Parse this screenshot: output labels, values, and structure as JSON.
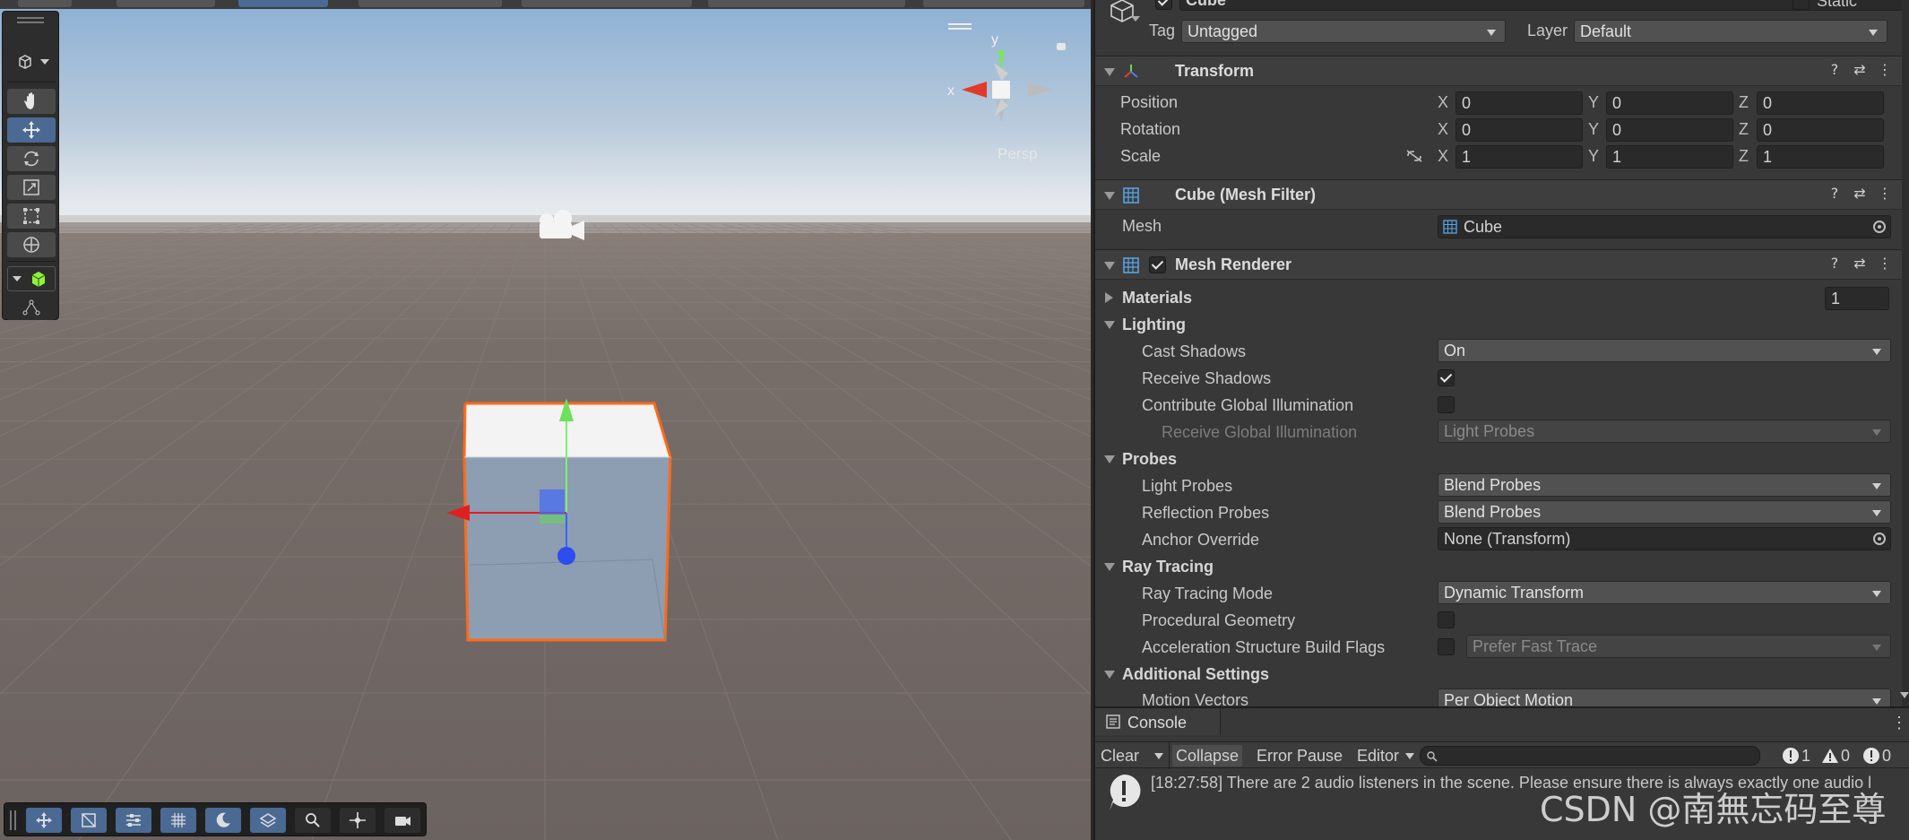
{
  "scene": {
    "gizmo": {
      "persp_label": "Persp",
      "x_label": "x",
      "y_label": "y"
    },
    "tools": [
      "hand-tool",
      "move-tool",
      "rotate-tool",
      "scale-tool",
      "rect-tool",
      "transform-tool",
      "custom-tool",
      "component-tool"
    ],
    "bottom_tools": [
      "move-view",
      "grid-snap",
      "align-tool",
      "grid-tool",
      "orbit-tool",
      "snap-tool",
      "zoom-tool",
      "pivot-tool",
      "camera-tool"
    ]
  },
  "inspector": {
    "object_name": "Cube",
    "static_label": "Static",
    "tag_label": "Tag",
    "tag_value": "Untagged",
    "layer_label": "Layer",
    "layer_value": "Default",
    "transform": {
      "title": "Transform",
      "position_label": "Position",
      "rotation_label": "Rotation",
      "scale_label": "Scale",
      "axis_x": "X",
      "axis_y": "Y",
      "axis_z": "Z",
      "position": [
        "0",
        "0",
        "0"
      ],
      "rotation": [
        "0",
        "0",
        "0"
      ],
      "scale": [
        "1",
        "1",
        "1"
      ]
    },
    "mesh_filter": {
      "title": "Cube (Mesh Filter)",
      "mesh_label": "Mesh",
      "mesh_value": "Cube"
    },
    "mesh_renderer": {
      "title": "Mesh Renderer",
      "materials_label": "Materials",
      "materials_count": "1",
      "lighting_label": "Lighting",
      "cast_shadows_label": "Cast Shadows",
      "cast_shadows_value": "On",
      "receive_shadows_label": "Receive Shadows",
      "contribute_gi_label": "Contribute Global Illumination",
      "receive_gi_label": "Receive Global Illumination",
      "receive_gi_value": "Light Probes",
      "probes_label": "Probes",
      "light_probes_label": "Light Probes",
      "light_probes_value": "Blend Probes",
      "reflection_probes_label": "Reflection Probes",
      "reflection_probes_value": "Blend Probes",
      "anchor_override_label": "Anchor Override",
      "anchor_override_value": "None (Transform)",
      "ray_tracing_label": "Ray Tracing",
      "ray_tracing_mode_label": "Ray Tracing Mode",
      "ray_tracing_mode_value": "Dynamic Transform",
      "procedural_geometry_label": "Procedural Geometry",
      "accel_flags_label": "Acceleration Structure Build Flags",
      "accel_flags_value": "Prefer Fast Trace",
      "additional_settings_label": "Additional Settings",
      "motion_vectors_label": "Motion Vectors",
      "motion_vectors_value": "Per Object Motion"
    }
  },
  "console": {
    "tab_label": "Console",
    "clear_label": "Clear",
    "collapse_label": "Collapse",
    "error_pause_label": "Error Pause",
    "editor_label": "Editor",
    "info_count": "1",
    "warning_count": "0",
    "error_count": "0",
    "message": "[18:27:58] There are 2 audio listeners in the scene. Please ensure there is always exactly one audio l"
  },
  "watermark": "CSDN @南無忘码至尊",
  "colors": {
    "accent": "#4a6a94",
    "selection_outline": "#ff6a1a",
    "panel": "#383838"
  }
}
